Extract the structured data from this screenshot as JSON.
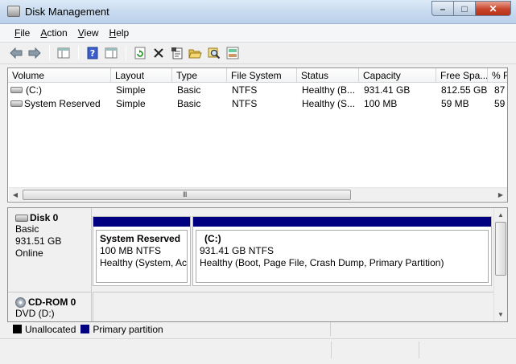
{
  "window": {
    "title": "Disk Management"
  },
  "menu": [
    {
      "label": "File",
      "underline": "F",
      "rest": "ile"
    },
    {
      "label": "Action",
      "underline": "A",
      "rest": "ction"
    },
    {
      "label": "View",
      "underline": "V",
      "rest": "iew"
    },
    {
      "label": "Help",
      "underline": "H",
      "rest": "elp"
    }
  ],
  "toolbar": {
    "icons": [
      "back-arrow-icon",
      "forward-arrow-icon",
      "console-tree-icon",
      "help-icon",
      "properties-pane-icon",
      "refresh-icon",
      "delete-icon",
      "properties-icon",
      "open-folder-icon",
      "explore-icon",
      "disk-settings-icon"
    ]
  },
  "volume_list": {
    "columns": [
      "Volume",
      "Layout",
      "Type",
      "File System",
      "Status",
      "Capacity",
      "Free Spa...",
      "% F"
    ],
    "rows": [
      {
        "volume": "(C:)",
        "layout": "Simple",
        "type": "Basic",
        "fs": "NTFS",
        "status": "Healthy (B...",
        "capacity": "931.41 GB",
        "free": "812.55 GB",
        "pct": "87"
      },
      {
        "volume": "System Reserved",
        "layout": "Simple",
        "type": "Basic",
        "fs": "NTFS",
        "status": "Healthy (S...",
        "capacity": "100 MB",
        "free": "59 MB",
        "pct": "59"
      }
    ],
    "scroll_grip": "III"
  },
  "disks": [
    {
      "name": "Disk 0",
      "type": "Basic",
      "size": "931.51 GB",
      "state": "Online",
      "partitions": [
        {
          "name": "System Reserved",
          "size": "100 MB NTFS",
          "status": "Healthy (System, Act"
        },
        {
          "name": "(C:)",
          "size": "931.41 GB NTFS",
          "status": "Healthy (Boot, Page File, Crash Dump, Primary Partition)"
        }
      ]
    },
    {
      "name": "CD-ROM 0",
      "type": "DVD (D:)"
    }
  ],
  "legend": [
    {
      "label": "Unallocated",
      "color": "#000000"
    },
    {
      "label": "Primary partition",
      "color": "#000080"
    }
  ]
}
